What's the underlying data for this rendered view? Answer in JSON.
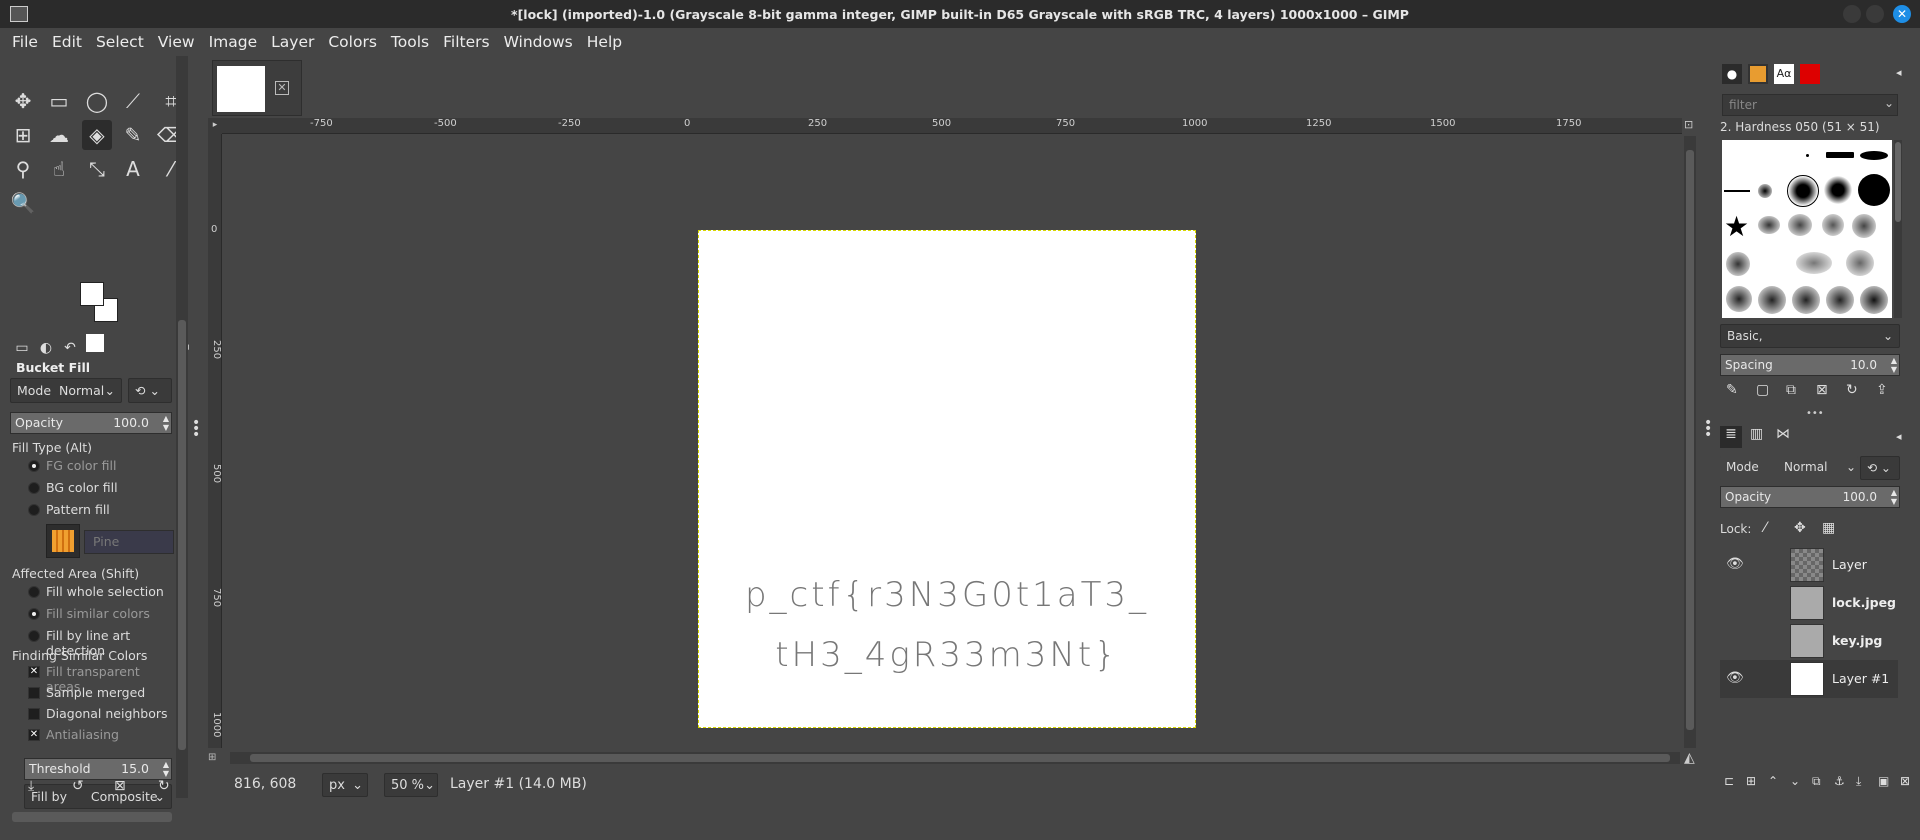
{
  "window": {
    "title": "*[lock] (imported)-1.0 (Grayscale 8-bit gamma integer, GIMP built-in D65 Grayscale with sRGB TRC, 4 layers) 1000x1000 – GIMP"
  },
  "menu": [
    "File",
    "Edit",
    "Select",
    "View",
    "Image",
    "Layer",
    "Colors",
    "Tools",
    "Filters",
    "Windows",
    "Help"
  ],
  "tool_options": {
    "title": "Bucket Fill",
    "mode_label": "Mode",
    "mode_value": "Normal",
    "opacity_label": "Opacity",
    "opacity_value": "100.0",
    "fill_type_label": "Fill Type  (Alt)",
    "fill_types": [
      "FG color fill",
      "BG color fill",
      "Pattern fill"
    ],
    "pattern_name": "Pine",
    "affected_label": "Affected Area  (Shift)",
    "affected": [
      "Fill whole selection",
      "Fill similar colors",
      "Fill by line art detection"
    ],
    "finding_label": "Finding Similar Colors",
    "options": [
      "Fill transparent areas",
      "Sample merged",
      "Diagonal neighbors",
      "Antialiasing"
    ],
    "threshold_label": "Threshold",
    "threshold_value": "15.0",
    "fillby_label": "Fill by",
    "fillby_value": "Composite"
  },
  "ruler": {
    "h_labels": [
      "-750",
      "-500",
      "-250",
      "0",
      "250",
      "500",
      "750",
      "1000",
      "1250",
      "1500",
      "1750"
    ],
    "v_labels": [
      "0",
      "250",
      "500",
      "750",
      "1000"
    ]
  },
  "canvas": {
    "line1": "p_ctf{r3N3G0t1aT3_",
    "line2": "tH3_4gR33m3Nt}"
  },
  "status": {
    "coords": "816, 608",
    "unit": "px",
    "zoom": "50 %",
    "layer_info": "Layer #1 (14.0 MB)"
  },
  "brushes": {
    "filter_placeholder": "filter",
    "selected": "2. Hardness 050 (51 × 51)",
    "preset": "Basic,",
    "spacing_label": "Spacing",
    "spacing_value": "10.0"
  },
  "layers": {
    "mode_label": "Mode",
    "mode_value": "Normal",
    "opacity_label": "Opacity",
    "opacity_value": "100.0",
    "lock_label": "Lock:",
    "items": [
      {
        "name": "Layer",
        "visible": true
      },
      {
        "name": "lock.jpeg",
        "visible": false
      },
      {
        "name": "key.jpg",
        "visible": false
      },
      {
        "name": "Layer #1",
        "visible": true
      }
    ]
  }
}
